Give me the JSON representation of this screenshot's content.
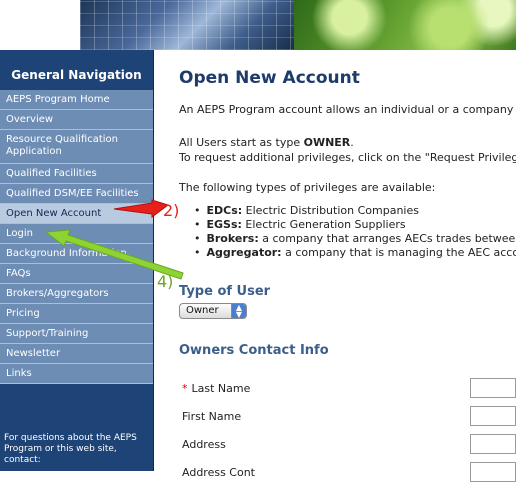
{
  "sidebar": {
    "title": "General Navigation",
    "items": [
      {
        "label": "AEPS Program Home"
      },
      {
        "label": "Overview"
      },
      {
        "label": "Resource Qualification Application"
      },
      {
        "label": "Qualified Facilities"
      },
      {
        "label": "Qualified DSM/EE Facilities"
      },
      {
        "label": "Open New Account",
        "active": true
      },
      {
        "label": "Login"
      },
      {
        "label": "Background Information"
      },
      {
        "label": "FAQs"
      },
      {
        "label": "Brokers/Aggregators"
      },
      {
        "label": "Pricing"
      },
      {
        "label": "Support/Training"
      },
      {
        "label": "Newsletter"
      },
      {
        "label": "Links"
      }
    ],
    "footer": "For questions about the AEPS Program or this web site, contact:"
  },
  "main": {
    "title": "Open New Account",
    "intro": "An AEPS Program account allows an individual or a company",
    "owner_prefix": "All Users start as type ",
    "owner_bold": "OWNER",
    "owner_suffix": ".",
    "request_line": "To request additional privileges, click on the \"Request Privileg",
    "privileges_intro": "The following types of privileges are available:",
    "privileges": [
      {
        "term": "EDCs:",
        "desc": " Electric Distribution Companies"
      },
      {
        "term": "EGSs:",
        "desc": " Electric Generation Suppliers"
      },
      {
        "term": "Brokers:",
        "desc": " a company that arranges AECs trades betwee"
      },
      {
        "term": "Aggregator:",
        "desc": " a company that is managing the AEC acco"
      }
    ],
    "type_heading": "Type of User",
    "type_select_value": "Owner",
    "contact_heading": "Owners Contact Info",
    "fields": [
      {
        "label": "Last Name",
        "required": true,
        "value": ""
      },
      {
        "label": "First Name",
        "required": false,
        "value": ""
      },
      {
        "label": "Address",
        "required": false,
        "value": ""
      },
      {
        "label": "Address Cont",
        "required": false,
        "value": ""
      }
    ]
  },
  "annotations": {
    "red_label": "2)",
    "green_label": "4)",
    "red_color": "#e8201c",
    "green_color": "#8ed334"
  }
}
